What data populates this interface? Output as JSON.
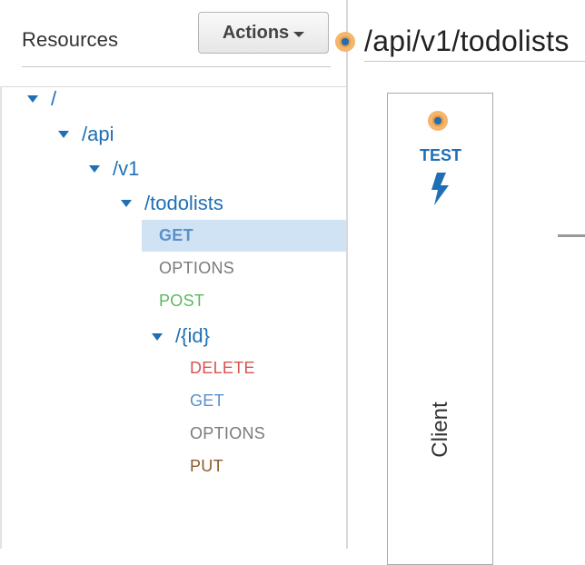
{
  "left_panel": {
    "title": "Resources",
    "actions_label": "Actions"
  },
  "tree": {
    "root": "/",
    "api": "/api",
    "v1": "/v1",
    "todolists": "/todolists",
    "todolists_methods": [
      "GET",
      "OPTIONS",
      "POST"
    ],
    "id": "/{id}",
    "id_methods": [
      "DELETE",
      "GET",
      "OPTIONS",
      "PUT"
    ],
    "selected": "GET"
  },
  "right_panel": {
    "path_title": "/api/v1/todolists",
    "test_label": "TEST",
    "client_label": "Client"
  },
  "colors": {
    "link_blue": "#1f6fb5",
    "get": "#5b8fc9",
    "options": "#7a7a7a",
    "post": "#5cb85c",
    "delete": "#d9534f",
    "put": "#8b5a2b",
    "selected_bg": "#cfe3f5",
    "status_dot_ring": "#f39b36"
  },
  "icons": {
    "tree_toggle": "caret-down-icon",
    "status_dot": "status-dot-icon",
    "test_bolt": "lightning-bolt-icon"
  }
}
